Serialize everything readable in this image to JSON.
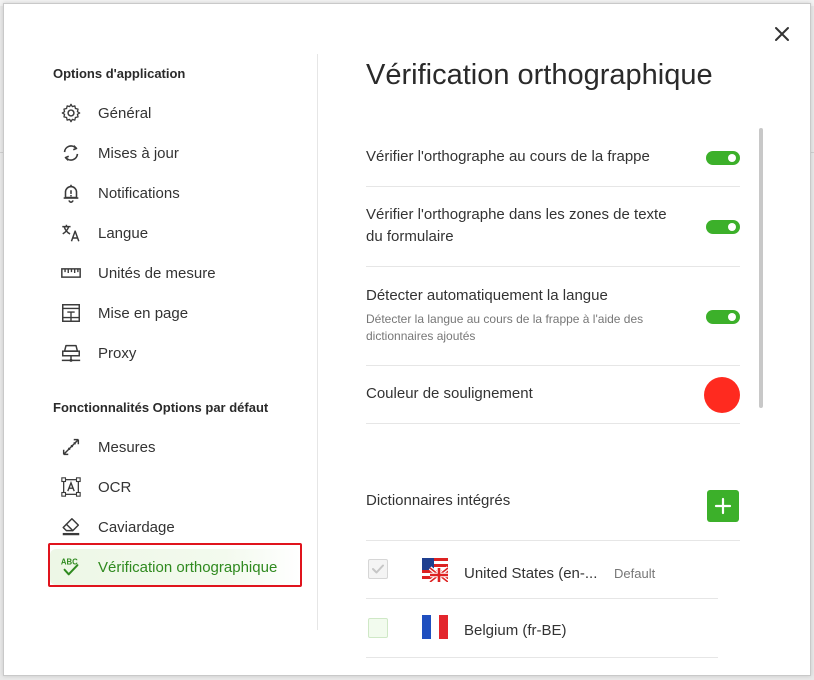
{
  "sidebar": {
    "section1_title": "Options d'application",
    "section1_items": [
      {
        "label": "Général",
        "icon": "gear-icon"
      },
      {
        "label": "Mises à jour",
        "icon": "refresh-icon"
      },
      {
        "label": "Notifications",
        "icon": "bell-icon"
      },
      {
        "label": "Langue",
        "icon": "translate-icon"
      },
      {
        "label": "Unités de mesure",
        "icon": "ruler-icon"
      },
      {
        "label": "Mise en page",
        "icon": "layout-icon"
      },
      {
        "label": "Proxy",
        "icon": "network-icon"
      }
    ],
    "section2_title": "Fonctionnalités Options par défaut",
    "section2_items": [
      {
        "label": "Mesures",
        "icon": "measure-icon"
      },
      {
        "label": "OCR",
        "icon": "ocr-icon"
      },
      {
        "label": "Caviardage",
        "icon": "eraser-icon"
      },
      {
        "label": "Vérification orthographique",
        "icon": "spellcheck-icon",
        "active": true
      }
    ],
    "spellcheck_icon_text": "ABC"
  },
  "main": {
    "title": "Vérification orthographique",
    "settings": [
      {
        "label": "Vérifier l'orthographe au cours de la frappe",
        "enabled": true
      },
      {
        "label": "Vérifier l'orthographe dans les zones de texte du formulaire",
        "enabled": true
      },
      {
        "label": "Détecter automatiquement la langue",
        "description": "Détecter la langue au cours de la frappe à l'aide des dictionnaires ajoutés",
        "enabled": true
      }
    ],
    "underline_color_label": "Couleur de soulignement",
    "underline_color": "#ff2a1f",
    "dictionaries_heading": "Dictionnaires intégrés",
    "dictionaries": [
      {
        "name": "United States (en-...",
        "badge": "Default",
        "flag": "us-flag-icon",
        "checked": true
      },
      {
        "name": "Belgium (fr-BE)",
        "badge": "",
        "flag": "fr-flag-icon",
        "checked": false
      }
    ]
  },
  "colors": {
    "accent_green": "#3cb02a",
    "active_text": "#2f8a1f",
    "highlight_red": "#e0141d"
  }
}
